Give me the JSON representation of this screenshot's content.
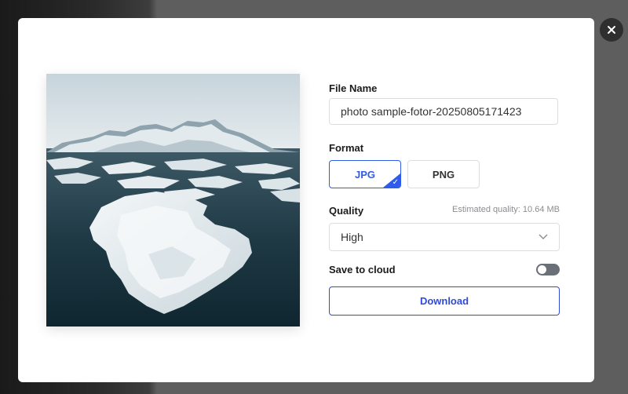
{
  "dialog": {
    "close_icon": "close-icon",
    "preview_alt": "photo-preview"
  },
  "file_name": {
    "label": "File Name",
    "value": "photo sample-fotor-20250805171423"
  },
  "format": {
    "label": "Format",
    "options": [
      "JPG",
      "PNG"
    ],
    "selected": "JPG"
  },
  "quality": {
    "label": "Quality",
    "estimate": "Estimated quality: 10.64 MB",
    "value": "High"
  },
  "cloud": {
    "label": "Save to cloud",
    "enabled": false
  },
  "download": {
    "label": "Download"
  },
  "colors": {
    "accent": "#2f5bea",
    "download_border": "#2f4bd6",
    "toggle_off": "#6b6f78"
  }
}
